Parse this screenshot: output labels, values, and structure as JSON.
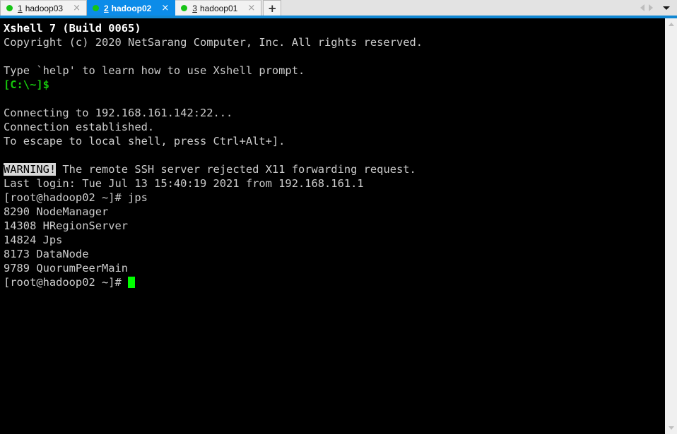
{
  "tabbar": {
    "tabs": [
      {
        "number": "1",
        "label": "hadoop03",
        "status_icon": "green-dot-icon",
        "close_icon": "×",
        "active": false
      },
      {
        "number": "2",
        "label": "hadoop02",
        "status_icon": "green-dot-icon",
        "close_icon": "×",
        "active": true
      },
      {
        "number": "3",
        "label": "hadoop01",
        "status_icon": "green-dot-icon",
        "close_icon": "×",
        "active": false
      }
    ],
    "new_tab_label": "+",
    "nav": {
      "prev_icon": "triangle-left-icon",
      "next_icon": "triangle-right-icon",
      "list_icon": "chevron-down-icon"
    },
    "active_color": "#0c8ce9",
    "status_color": "#16c416"
  },
  "terminal": {
    "background": "#000000",
    "foreground": "#cccccc",
    "prompt_color": "#16c60c",
    "cursor_color": "#00ff00",
    "lines": [
      {
        "type": "bold",
        "text": "Xshell 7 (Build 0065)"
      },
      {
        "type": "normal",
        "text": "Copyright (c) 2020 NetSarang Computer, Inc. All rights reserved."
      },
      {
        "type": "normal",
        "text": ""
      },
      {
        "type": "normal",
        "text": "Type `help' to learn how to use Xshell prompt."
      },
      {
        "type": "prompt",
        "text": "[C:\\~]$"
      },
      {
        "type": "normal",
        "text": ""
      },
      {
        "type": "normal",
        "text": "Connecting to 192.168.161.142:22..."
      },
      {
        "type": "normal",
        "text": "Connection established."
      },
      {
        "type": "normal",
        "text": "To escape to local shell, press Ctrl+Alt+]."
      },
      {
        "type": "normal",
        "text": ""
      },
      {
        "type": "warning",
        "badge": "WARNING!",
        "text": " The remote SSH server rejected X11 forwarding request."
      },
      {
        "type": "normal",
        "text": "Last login: Tue Jul 13 15:40:19 2021 from 192.168.161.1"
      },
      {
        "type": "normal",
        "text": "[root@hadoop02 ~]# jps"
      },
      {
        "type": "normal",
        "text": "8290 NodeManager"
      },
      {
        "type": "normal",
        "text": "14308 HRegionServer"
      },
      {
        "type": "normal",
        "text": "14824 Jps"
      },
      {
        "type": "normal",
        "text": "8173 DataNode"
      },
      {
        "type": "normal",
        "text": "9789 QuorumPeerMain"
      },
      {
        "type": "cursorline",
        "text": "[root@hadoop02 ~]# "
      }
    ]
  },
  "scrollbar": {
    "up_icon": "scroll-up-arrow-icon",
    "down_icon": "scroll-down-arrow-icon"
  }
}
